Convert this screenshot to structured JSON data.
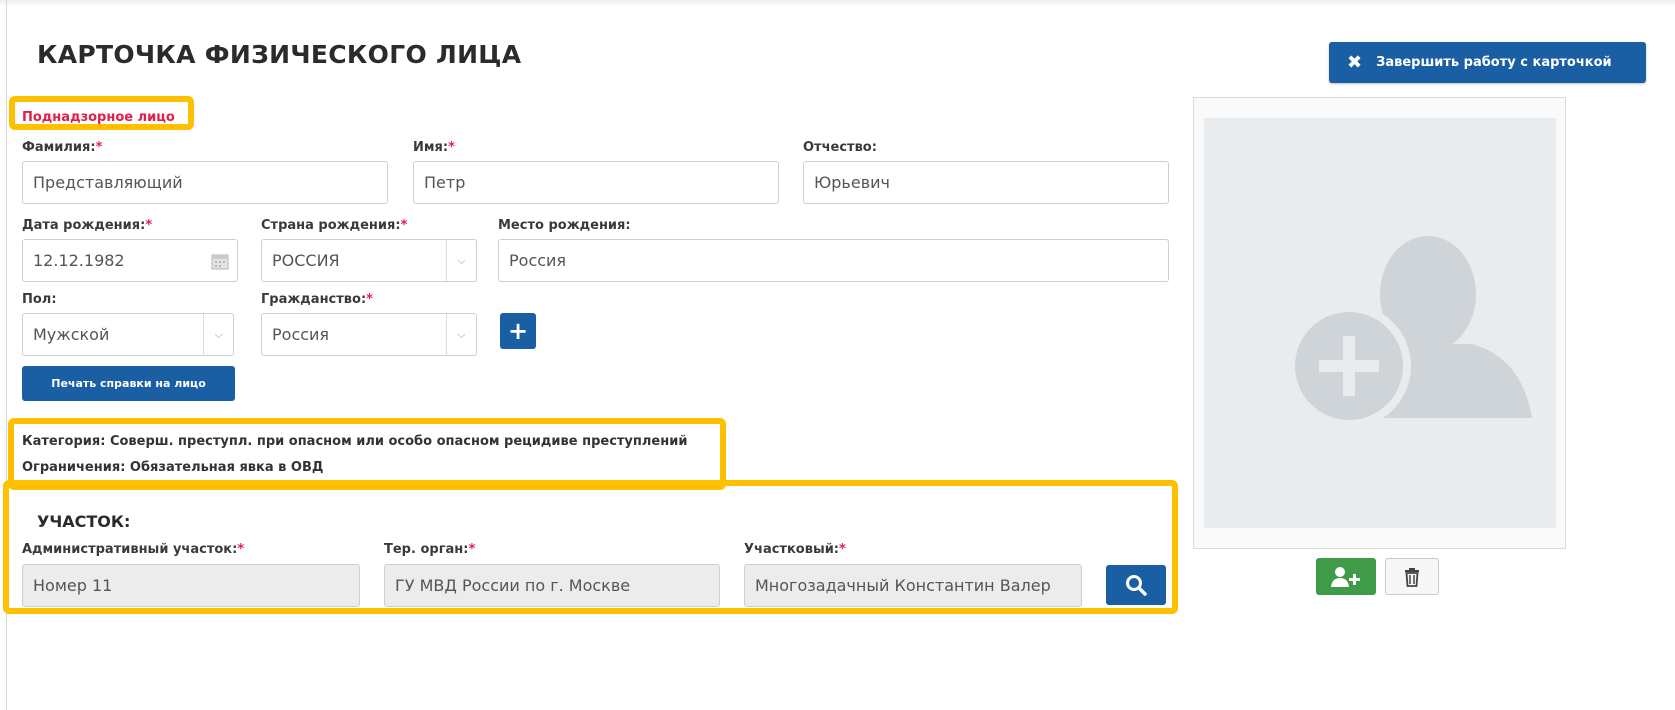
{
  "header": {
    "title": "КАРТОЧКА ФИЗИЧЕСКОГО ЛИЦА",
    "finish_button_label": "Завершить работу с карточкой"
  },
  "status": "Поднадзорное лицо",
  "form": {
    "required_mark": "*",
    "last_name": {
      "label": "Фамилия:",
      "value": "Представляющий"
    },
    "first_name": {
      "label": "Имя:",
      "value": "Петр"
    },
    "patronymic": {
      "label": "Отчество:",
      "value": "Юрьевич"
    },
    "birth_date": {
      "label": "Дата рождения:",
      "value": "12.12.1982"
    },
    "birth_country": {
      "label": "Страна рождения:",
      "value": "РОССИЯ"
    },
    "birth_place": {
      "label": "Место рождения:",
      "value": "Россия"
    },
    "gender": {
      "label": "Пол:",
      "value": "Мужской"
    },
    "citizenship": {
      "label": "Гражданство:",
      "value": "Россия"
    },
    "add_button_label": "+",
    "print_button_label": "Печать справки на лицо"
  },
  "info": {
    "category": "Категория: Соверш. преступл. при опасном или особо опасном рецидиве преступлений",
    "restrictions": "Ограничения: Обязательная явка в ОВД"
  },
  "district": {
    "title": "УЧАСТОК:",
    "admin_district": {
      "label": "Административный участок:",
      "value": "Номер 11"
    },
    "ter_organ": {
      "label": "Тер. орган:",
      "value": "ГУ МВД России по г. Москве"
    },
    "officer": {
      "label": "Участковый:",
      "value": "Многозадачный Константин Валер"
    }
  },
  "colors": {
    "primary": "#1a5fa3",
    "required": "#e0204a",
    "highlight": "#ffc000",
    "success": "#3f9b48"
  },
  "icons": {
    "finish": "close-icon",
    "calendar": "calendar-icon",
    "search": "search-icon",
    "add_photo": "add-user-icon",
    "delete_photo": "trash-icon",
    "placeholder": "user-placeholder-icon"
  }
}
